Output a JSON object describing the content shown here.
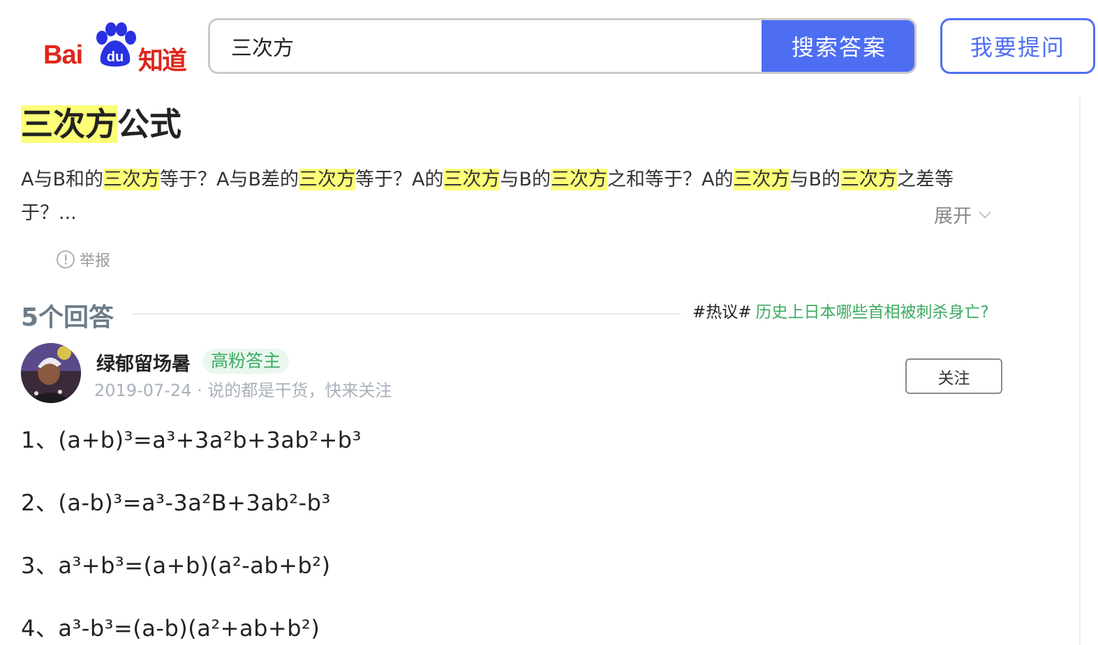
{
  "header": {
    "logo_text_left": "Bai",
    "logo_text_paw": "du",
    "logo_text_right": "知道",
    "search_value": "三次方",
    "search_button_label": "搜索答案",
    "ask_button_label": "我要提问"
  },
  "question": {
    "title_highlight": "三次方",
    "title_rest": "公式",
    "desc_segments": [
      {
        "t": "A与B和的",
        "hl": false
      },
      {
        "t": "三次方",
        "hl": true
      },
      {
        "t": "等于？A与B差的",
        "hl": false
      },
      {
        "t": "三次方",
        "hl": true
      },
      {
        "t": "等于？A的",
        "hl": false
      },
      {
        "t": "三次方",
        "hl": true
      },
      {
        "t": "与B的",
        "hl": false
      },
      {
        "t": "三次方",
        "hl": true
      },
      {
        "t": "之和等于？A的",
        "hl": false
      },
      {
        "t": "三次方",
        "hl": true
      },
      {
        "t": "与B的",
        "hl": false
      },
      {
        "t": "三次方",
        "hl": true
      },
      {
        "t": "之差等于？...",
        "hl": false
      }
    ],
    "expand_label": "展开",
    "report_label": "举报"
  },
  "answers": {
    "count_label": "5个回答",
    "hot_tag": "#热议#",
    "hot_link": "历史上日本哪些首相被刺杀身亡?"
  },
  "answer": {
    "author": "绿郁留场暑",
    "badge": "高粉答主",
    "meta": "2019-07-24 · 说的都是干货，快来关注",
    "follow_label": "关注",
    "formulas": [
      "1、(a+b)³=a³+3a²b+3ab²+b³",
      "2、(a-b)³=a³-3a²B+3ab²-b³",
      "3、a³+b³=(a+b)(a²-ab+b²)",
      "4、a³-b³=(a-b)(a²+ab+b²)"
    ]
  },
  "colors": {
    "brand_red": "#e1251b",
    "brand_blue": "#4e6ef2",
    "highlight": "#fcff77",
    "green": "#3dab62"
  }
}
